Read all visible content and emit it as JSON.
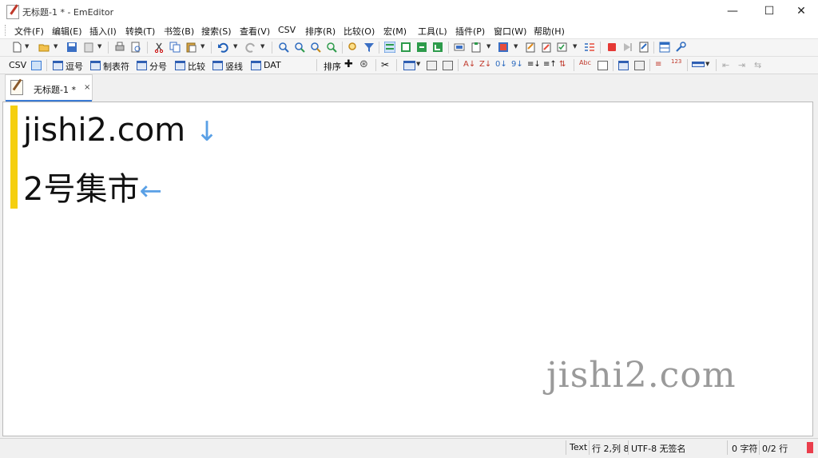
{
  "window": {
    "title": "无标题-1 * - EmEditor",
    "minimize": "—",
    "maximize": "☐",
    "close": "✕"
  },
  "menu": [
    "文件(F)",
    "编辑(E)",
    "插入(I)",
    "转换(T)",
    "书签(B)",
    "搜索(S)",
    "查看(V)",
    "CSV",
    "排序(R)",
    "比较(O)",
    "宏(M)",
    "工具(L)",
    "插件(P)",
    "窗口(W)",
    "帮助(H)"
  ],
  "toolbar2": {
    "csv": "CSV",
    "modes": [
      "逗号",
      "制表符",
      "分号",
      "比较",
      "竖线",
      "DAT"
    ],
    "sort": "排序"
  },
  "tab": {
    "label": "无标题-1 *",
    "close": "×"
  },
  "document": {
    "lines": [
      "jishi2.com",
      "2号集市"
    ],
    "eol_marks": [
      "↓",
      "←"
    ]
  },
  "watermark": "jishi2.com",
  "status": {
    "mode": "Text",
    "position": "行 2,列 8",
    "encoding": "UTF-8 无签名",
    "chars": "0 字符",
    "lines": "0/2 行"
  },
  "colors": {
    "accent": "#3a7bd5",
    "gutter": "#f5cf10",
    "eol": "#5aa0e6"
  }
}
